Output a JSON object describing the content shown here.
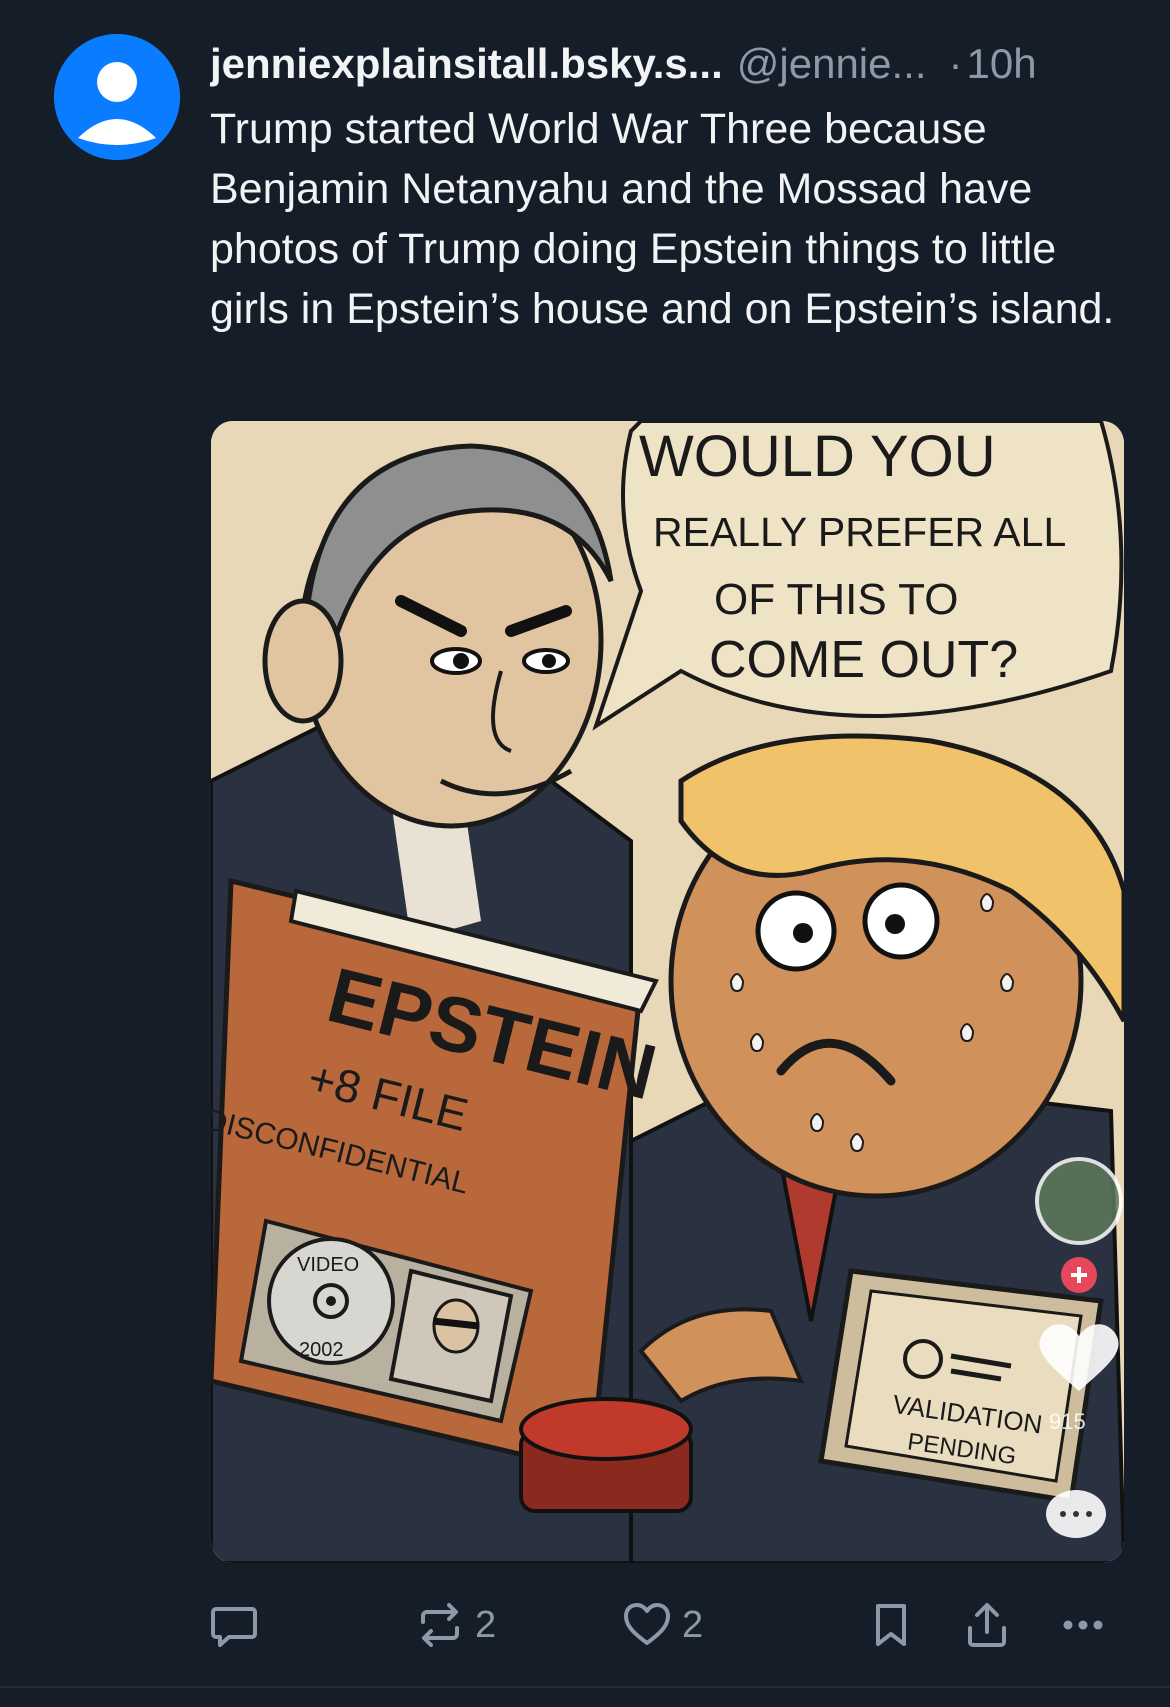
{
  "post": {
    "display_name": "jenniexplainsitall.bsky.s...",
    "handle": "@jennie...",
    "separator": "·",
    "time": "10h",
    "text": "Trump started World War Three because Benjamin Netanyahu and the Mossad have photos of Trump doing Epstein things to little girls in Epstein’s house and on Epstein’s island."
  },
  "image": {
    "speech_line1": "WOULD YOU",
    "speech_line2": "REALLY PREFER ALL",
    "speech_line3": "OF THIS TO",
    "speech_line4": "COME OUT?",
    "file_title": "EPSTEIN",
    "file_sub": "+8 FILE",
    "file_stamp": "DISCONFIDENTIAL",
    "disc_label": "VIDEO",
    "disc_year": "2002",
    "monitor_line1": "VALIDATION",
    "monitor_line2": "PENDING",
    "overlay_count": "915"
  },
  "actions": {
    "reply_count": "",
    "repost_count": "2",
    "like_count": "2"
  },
  "icons": {
    "reply": "reply-icon",
    "repost": "repost-icon",
    "like": "heart-icon",
    "bookmark": "bookmark-icon",
    "share": "share-icon",
    "more": "more-icon"
  },
  "colors": {
    "background": "#151d28",
    "avatar": "#0a7cff",
    "muted": "#8d99a6"
  }
}
